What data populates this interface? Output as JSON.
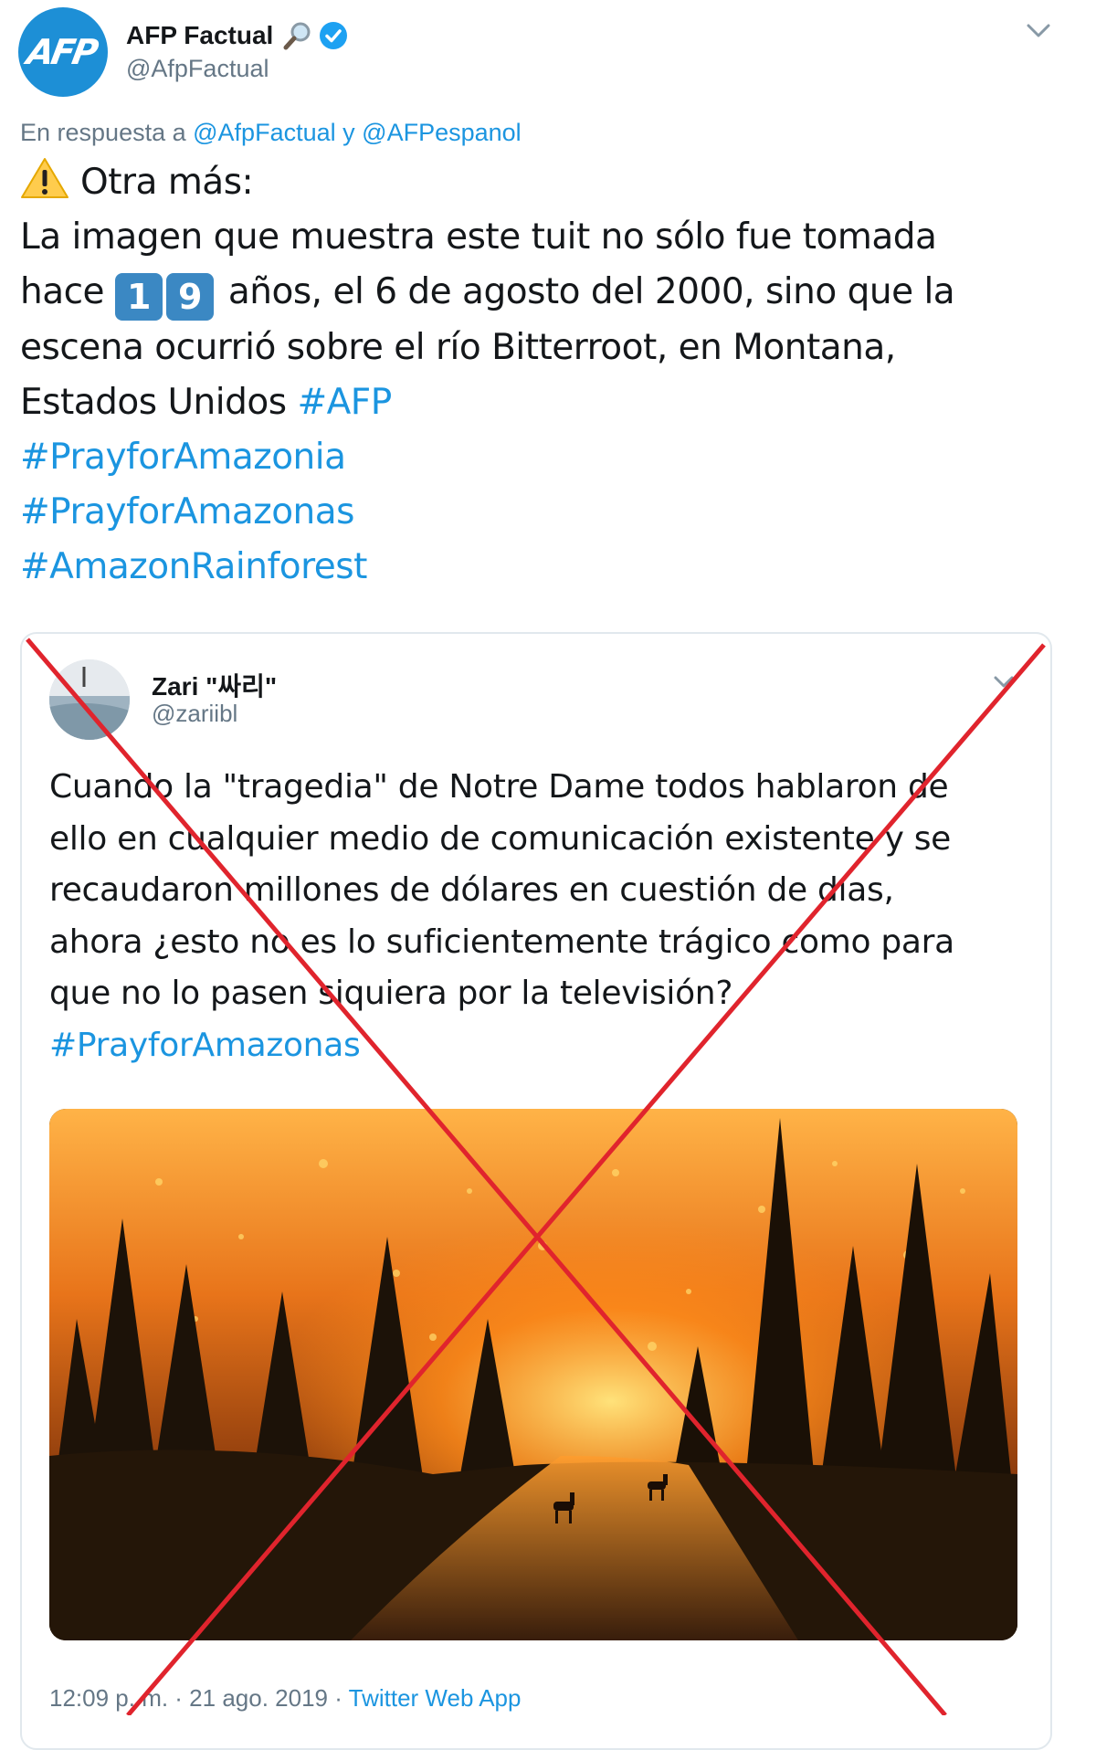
{
  "tweet": {
    "author_name": "AFP Factual",
    "author_handle": "@AfpFactual",
    "avatar_text": "AFP",
    "reply_prefix": "En respuesta a",
    "reply_user_1": "@AfpFactual",
    "reply_conjunction": "y",
    "reply_user_2": "@AFPespanol",
    "line1": "Otra más:",
    "line2": "La imagen que muestra este tuit no sólo fue tomada",
    "line3_prefix": "hace",
    "digit_1": "1",
    "digit_2": "9",
    "line3_suffix": "años, el 6 de agosto del 2000, sino que la",
    "line4": "escena ocurrió sobre el río Bitterroot, en Montana,",
    "line5": "Estados Unidos",
    "hashtag_afp": "#AFP",
    "hashtag_1": "#PrayforAmazonia",
    "hashtag_2": "#PrayforAmazonas",
    "hashtag_3": "#AmazonRainforest"
  },
  "quoted_tweet": {
    "author_name": "Zari \"싸리\"",
    "author_handle": "@zariibl",
    "line1": "Cuando la \"tragedia\" de Notre Dame todos hablaron de",
    "line2": "ello en cualquier medio de comunicación existente y se",
    "line3": "recaudaron millones de dólares en cuestión de días,",
    "line4": "ahora ¿esto no es lo suficientemente trágico como para",
    "line5": "que no lo pasen siquiera por la televisión?",
    "hashtag": "#PrayforAmazonas",
    "timestamp": "12:09 p. m. · 21 ago. 2019 ·",
    "source": "Twitter Web App"
  },
  "icons": {
    "warning": "warning-icon",
    "magnifier": "magnifying-glass-icon",
    "verified": "verified-badge-icon",
    "caret": "chevron-down-icon"
  },
  "colors": {
    "link": "#1b95e0",
    "verified": "#1da1f2",
    "cross": "#e0242d",
    "avatar_bg": "#1d8fd6"
  }
}
